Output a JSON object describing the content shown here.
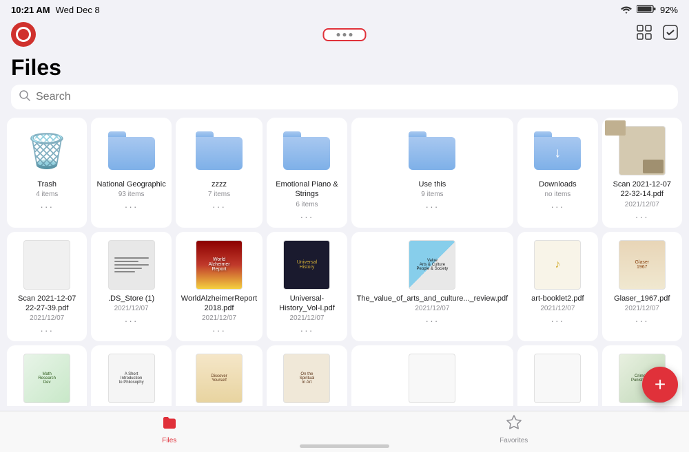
{
  "status_bar": {
    "time": "10:21 AM",
    "date": "Wed Dec 8",
    "battery": "92%",
    "wifi": true
  },
  "toolbar": {
    "dots_label": "• • •",
    "logo_alt": "Files App Logo"
  },
  "page": {
    "title": "Files",
    "search_placeholder": "Search"
  },
  "tabs": [
    {
      "id": "files",
      "label": "Files",
      "active": true
    },
    {
      "id": "favorites",
      "label": "Favorites",
      "active": false
    }
  ],
  "row1": [
    {
      "id": "trash",
      "name": "Trash",
      "meta": "4 items",
      "type": "trash"
    },
    {
      "id": "national-geo",
      "name": "National Geographic",
      "meta": "93 items",
      "type": "folder"
    },
    {
      "id": "zzzz",
      "name": "zzzz",
      "meta": "7 items",
      "type": "folder"
    },
    {
      "id": "emotional-piano",
      "name": "Emotional Piano & Strings",
      "meta": "6 items",
      "type": "folder"
    },
    {
      "id": "use-this",
      "name": "Use this",
      "meta": "9 items",
      "type": "folder"
    },
    {
      "id": "downloads",
      "name": "Downloads",
      "meta": "no items",
      "type": "folder-download"
    },
    {
      "id": "scan-2021-1",
      "name": "Scan 2021-12-07 22-32-14.pdf",
      "meta": "2021/12/07",
      "type": "photo-pdf"
    }
  ],
  "row2": [
    {
      "id": "scan-2021-2",
      "name": "Scan 2021-12-07 22-27-39.pdf",
      "meta": "2021/12/07",
      "type": "grid-pdf"
    },
    {
      "id": "ds-store",
      "name": ".DS_Store (1)",
      "meta": "2021/12/07",
      "type": "ds-store-pdf"
    },
    {
      "id": "alzheimer",
      "name": "WorldAlzheimerReport 2018.pdf",
      "meta": "2021/12/07",
      "type": "alzheimer-pdf"
    },
    {
      "id": "history",
      "name": "Universal-History_Vol-I.pdf",
      "meta": "2021/12/07",
      "type": "history-pdf"
    },
    {
      "id": "arts",
      "name": "The_value_of_arts_and_culture..._review.pdf",
      "meta": "2021/12/07",
      "type": "arts-pdf"
    },
    {
      "id": "artbooklet",
      "name": "art-booklet2.pdf",
      "meta": "2021/12/07",
      "type": "artbooklet-pdf"
    },
    {
      "id": "glaser",
      "name": "Glaser_1967.pdf",
      "meta": "2021/12/07",
      "type": "glaser-pdf"
    }
  ],
  "row3": [
    {
      "id": "math-r",
      "name": "",
      "meta": "",
      "type": "math-pdf"
    },
    {
      "id": "intro",
      "name": "",
      "meta": "",
      "type": "intro-pdf"
    },
    {
      "id": "discover",
      "name": "",
      "meta": "",
      "type": "discover-pdf"
    },
    {
      "id": "spiritual",
      "name": "",
      "meta": "",
      "type": "spiritual-pdf"
    },
    {
      "id": "blank1",
      "name": "",
      "meta": "",
      "type": "blank-pdf"
    },
    {
      "id": "blank2",
      "name": "",
      "meta": "",
      "type": "blank2-pdf"
    },
    {
      "id": "crime",
      "name": "",
      "meta": "",
      "type": "crime-pdf"
    }
  ],
  "fab": {
    "label": "+"
  }
}
